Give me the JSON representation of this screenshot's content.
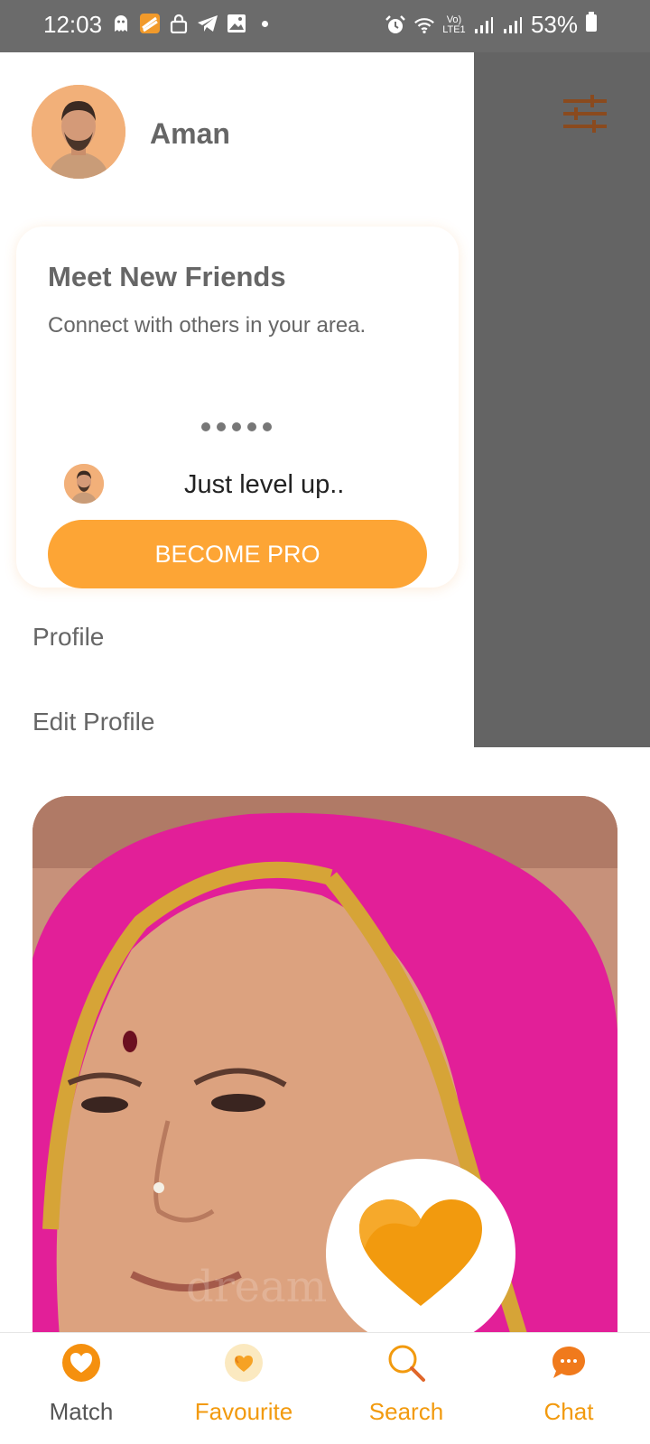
{
  "status_bar": {
    "time": "12:03",
    "network": "Vo) LTE1",
    "battery": "53%",
    "icons": [
      "ghost-icon",
      "app-icon",
      "lock-icon",
      "telegram-icon",
      "gallery-icon",
      "alarm-icon",
      "wifi-icon",
      "signal-icon",
      "signal-icon",
      "battery-icon"
    ]
  },
  "drawer": {
    "user_name": "Aman",
    "promo": {
      "title": "Meet New Friends",
      "subtitle": "Connect with others in your area.",
      "level_text": "Just level up..",
      "button_label": "BECOME PRO"
    },
    "menu": [
      {
        "label": "Profile"
      },
      {
        "label": "Edit Profile"
      }
    ]
  },
  "card": {
    "watermark": "dream"
  },
  "bottom_nav": {
    "items": [
      {
        "label": "Match",
        "icon": "heart-circle-icon"
      },
      {
        "label": "Favourite",
        "icon": "hearts-icon"
      },
      {
        "label": "Search",
        "icon": "search-icon"
      },
      {
        "label": "Chat",
        "icon": "chat-bubble-icon"
      }
    ]
  },
  "colors": {
    "accent": "#fda535",
    "like_heart": "#f29a0e",
    "overlay": "#646464",
    "text_muted": "#666666"
  }
}
